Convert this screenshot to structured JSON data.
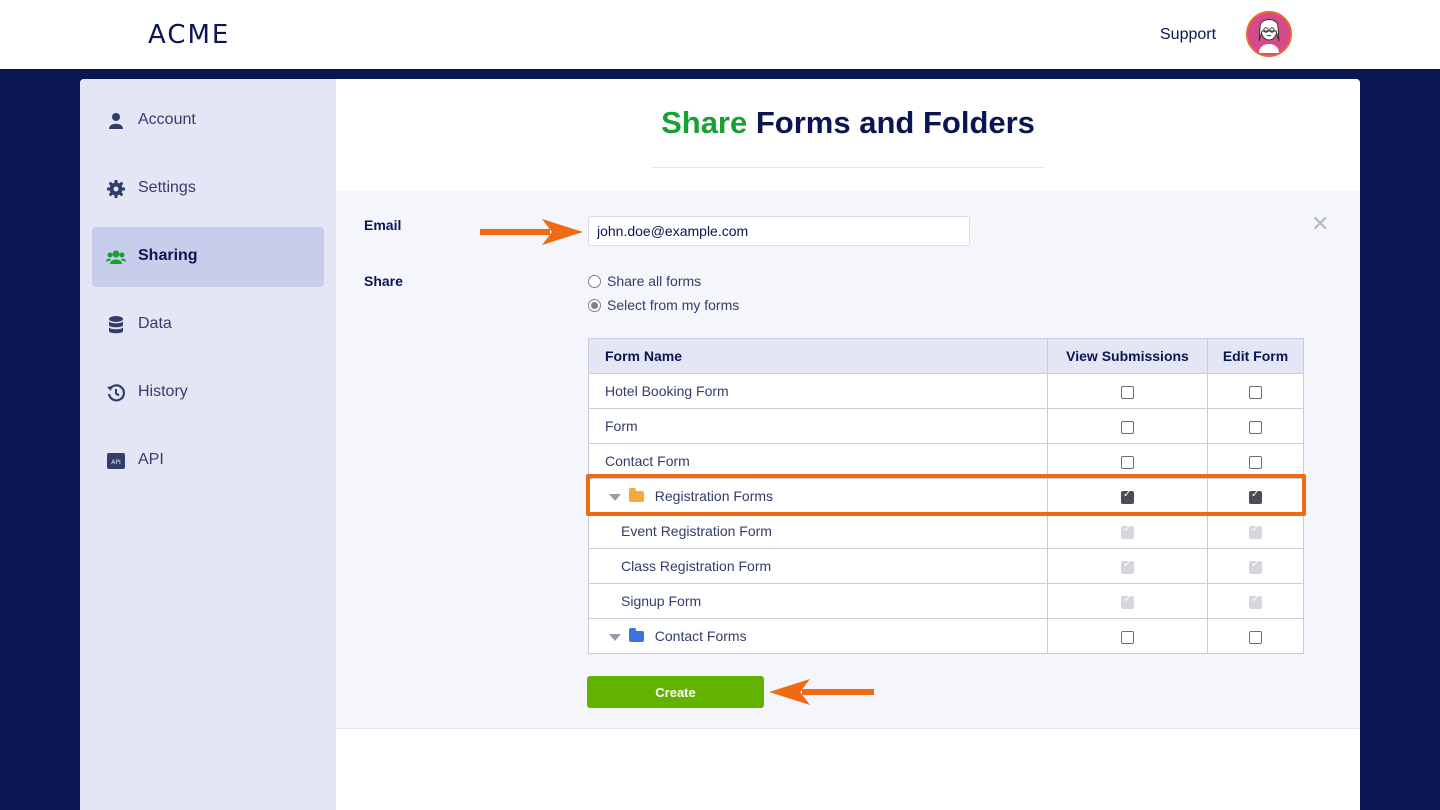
{
  "header": {
    "logo": "ACME",
    "support_label": "Support",
    "avatar_icon": "avatar-icon"
  },
  "sidebar": {
    "items": [
      {
        "label": "Account",
        "icon": "user-icon",
        "active": false
      },
      {
        "label": "Settings",
        "icon": "gear-icon",
        "active": false
      },
      {
        "label": "Sharing",
        "icon": "users-icon",
        "active": true
      },
      {
        "label": "Data",
        "icon": "database-icon",
        "active": false
      },
      {
        "label": "History",
        "icon": "history-icon",
        "active": false
      },
      {
        "label": "API",
        "icon": "api-icon",
        "active": false
      }
    ]
  },
  "main": {
    "title_accent": "Share",
    "title_rest": "Forms and Folders",
    "email_label": "Email",
    "email_value": "john.doe@example.com",
    "share_label": "Share",
    "share_options": [
      {
        "label": "Share all forms",
        "selected": false
      },
      {
        "label": "Select from my forms",
        "selected": true
      }
    ],
    "table": {
      "headers": [
        "Form Name",
        "View Submissions",
        "Edit Form"
      ],
      "rows": [
        {
          "name": "Hotel Booking Form",
          "type": "form",
          "view": false,
          "edit": false
        },
        {
          "name": "Form",
          "type": "form",
          "view": false,
          "edit": false
        },
        {
          "name": "Contact Form",
          "type": "form",
          "view": false,
          "edit": false
        },
        {
          "name": "Registration Forms",
          "type": "folder",
          "folder_color": "#f3a93b",
          "view": true,
          "edit": true
        },
        {
          "name": "Event Registration Form",
          "type": "child",
          "view": true,
          "edit": true,
          "disabled": true
        },
        {
          "name": "Class Registration Form",
          "type": "child",
          "view": true,
          "edit": true,
          "disabled": true
        },
        {
          "name": "Signup Form",
          "type": "child",
          "view": true,
          "edit": true,
          "disabled": true
        },
        {
          "name": "Contact Forms",
          "type": "folder",
          "folder_color": "#3f74e0",
          "view": false,
          "edit": false
        }
      ]
    },
    "create_label": "Create",
    "close_icon": "close-icon"
  },
  "colors": {
    "navy": "#0a1551",
    "accent_green": "#18a034",
    "button_green": "#64b200",
    "highlight_orange": "#f06a14"
  }
}
